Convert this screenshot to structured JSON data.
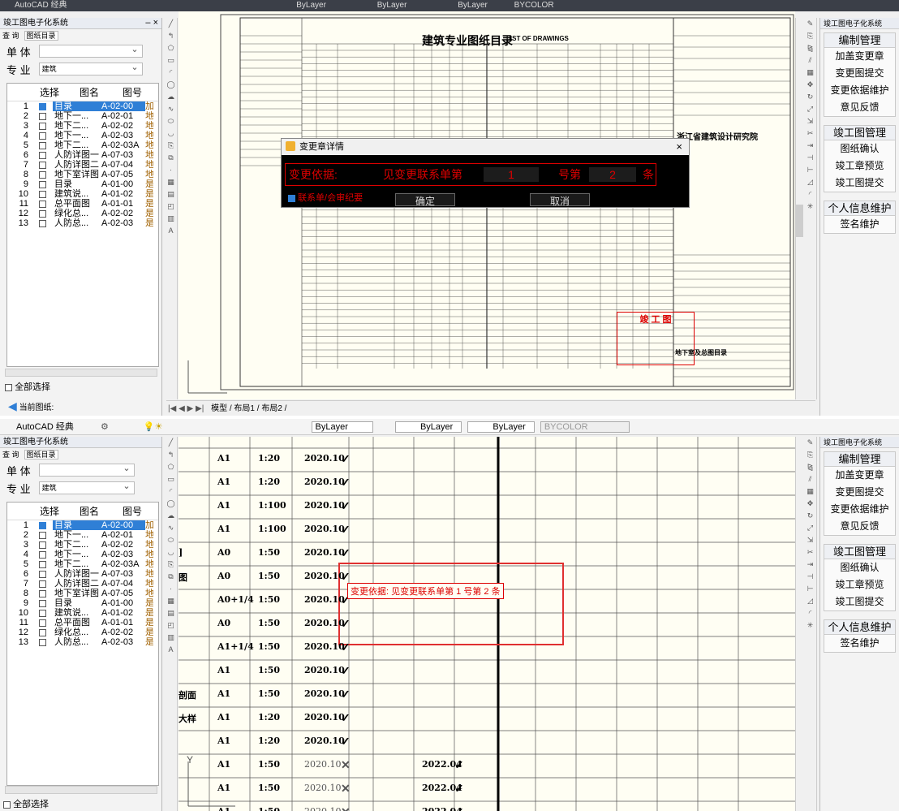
{
  "app": {
    "title": "AutoCAD 经典",
    "layer": "ByLayer",
    "linetype": "ByLayer",
    "lineweight": "ByLayer",
    "color": "BYCOLOR"
  },
  "left_panel": {
    "title": "竣工图电子化系统",
    "tabs": [
      "查 询",
      "图纸目录"
    ],
    "unit_label": "单 体",
    "unit_value": "",
    "major_label": "专 业",
    "major_value": "建筑",
    "headers": [
      "选择",
      "图名",
      "图号"
    ],
    "rows": [
      {
        "idx": "1",
        "checked": true,
        "name": "目录",
        "code": "A-02-00",
        "extra": "加"
      },
      {
        "idx": "2",
        "checked": false,
        "name": "地下一...",
        "code": "A-02-01",
        "extra": "地"
      },
      {
        "idx": "3",
        "checked": false,
        "name": "地下二...",
        "code": "A-02-02",
        "extra": "地"
      },
      {
        "idx": "4",
        "checked": false,
        "name": "地下一...",
        "code": "A-02-03",
        "extra": "地"
      },
      {
        "idx": "5",
        "checked": false,
        "name": "地下二...",
        "code": "A-02-03A",
        "extra": "地"
      },
      {
        "idx": "6",
        "checked": false,
        "name": "人防详图一",
        "code": "A-07-03",
        "extra": "地"
      },
      {
        "idx": "7",
        "checked": false,
        "name": "人防详图二",
        "code": "A-07-04",
        "extra": "地"
      },
      {
        "idx": "8",
        "checked": false,
        "name": "地下室详图",
        "code": "A-07-05",
        "extra": "地"
      },
      {
        "idx": "9",
        "checked": false,
        "name": "目录",
        "code": "A-01-00",
        "extra": "是"
      },
      {
        "idx": "10",
        "checked": false,
        "name": "建筑说...",
        "code": "A-01-02",
        "extra": "是"
      },
      {
        "idx": "11",
        "checked": false,
        "name": "总平面图",
        "code": "A-01-01",
        "extra": "是"
      },
      {
        "idx": "12",
        "checked": false,
        "name": "绿化总...",
        "code": "A-02-02",
        "extra": "是"
      },
      {
        "idx": "13",
        "checked": false,
        "name": "人防总...",
        "code": "A-02-03",
        "extra": "是"
      }
    ],
    "select_all": "全部选择",
    "current_drawing": "当前图纸:"
  },
  "right_panel": {
    "title": "竣工图电子化系统",
    "sections": [
      {
        "header": "编制管理",
        "items": [
          "加盖变更章",
          "变更图提交",
          "变更依据维护",
          "意见反馈"
        ]
      },
      {
        "header": "竣工图管理",
        "items": [
          "图纸确认",
          "竣工章预览",
          "竣工图提交"
        ]
      },
      {
        "header": "个人信息维护",
        "items": [
          "签名维护"
        ]
      }
    ]
  },
  "dialog": {
    "title": "变更章详情",
    "basis_label": "变更依据:",
    "prefix": "见变更联系单第",
    "sheet_no": "1",
    "middle": "号第",
    "item_no": "2",
    "suffix": "条",
    "checkbox_label": "联系单/会审纪要",
    "ok": "确定",
    "cancel": "取消"
  },
  "layout_tabs": [
    "模型",
    "布局1",
    "布局2"
  ],
  "drawing": {
    "title": "建筑专业图纸目录",
    "title_en": "LIST OF DRAWINGS",
    "institute": "浙江省建筑设计研究院",
    "stamp_title": "竣 工 图",
    "project": "地下室及总图目录",
    "stamp_text": "变更依据: 见变更联系单第 1 号第 2 条"
  },
  "detail_rows": [
    {
      "size": "A1",
      "scale": "1:20",
      "date": "2020.10",
      "mark": "✓",
      "label": "",
      "date2": "",
      "mark2": ""
    },
    {
      "size": "A1",
      "scale": "1:20",
      "date": "2020.10",
      "mark": "✓",
      "label": "",
      "date2": "",
      "mark2": ""
    },
    {
      "size": "A1",
      "scale": "1:100",
      "date": "2020.10",
      "mark": "✓",
      "label": "",
      "date2": "",
      "mark2": ""
    },
    {
      "size": "A1",
      "scale": "1:100",
      "date": "2020.10",
      "mark": "✓",
      "label": "",
      "date2": "",
      "mark2": ""
    },
    {
      "size": "A0",
      "scale": "1:50",
      "date": "2020.10",
      "mark": "✓",
      "label": "]",
      "date2": "",
      "mark2": ""
    },
    {
      "size": "A0",
      "scale": "1:50",
      "date": "2020.10",
      "mark": "✓",
      "label": "图",
      "date2": "",
      "mark2": ""
    },
    {
      "size": "A0+1/4",
      "scale": "1:50",
      "date": "2020.10",
      "mark": "✓",
      "label": "",
      "date2": "",
      "mark2": ""
    },
    {
      "size": "A0",
      "scale": "1:50",
      "date": "2020.10",
      "mark": "✓",
      "label": "",
      "date2": "",
      "mark2": ""
    },
    {
      "size": "A1+1/4",
      "scale": "1:50",
      "date": "2020.10",
      "mark": "✓",
      "label": "",
      "date2": "",
      "mark2": ""
    },
    {
      "size": "A1",
      "scale": "1:50",
      "date": "2020.10",
      "mark": "✓",
      "label": "",
      "date2": "",
      "mark2": ""
    },
    {
      "size": "A1",
      "scale": "1:50",
      "date": "2020.10",
      "mark": "✓",
      "label": "剖面",
      "date2": "",
      "mark2": ""
    },
    {
      "size": "A1",
      "scale": "1:20",
      "date": "2020.10",
      "mark": "✓",
      "label": "大样",
      "date2": "",
      "mark2": ""
    },
    {
      "size": "A1",
      "scale": "1:20",
      "date": "2020.10",
      "mark": "✓",
      "label": "",
      "date2": "",
      "mark2": ""
    },
    {
      "size": "A1",
      "scale": "1:50",
      "date": "2020.10",
      "mark": "✕",
      "label": "",
      "date2": "2022.04",
      "mark2": "✓"
    },
    {
      "size": "A1",
      "scale": "1:50",
      "date": "2020.10",
      "mark": "✕",
      "label": "",
      "date2": "2022.04",
      "mark2": "✓"
    },
    {
      "size": "A1",
      "scale": "1:50",
      "date": "2020.10",
      "mark": "✕",
      "label": "",
      "date2": "2022.04",
      "mark2": "✓"
    }
  ]
}
